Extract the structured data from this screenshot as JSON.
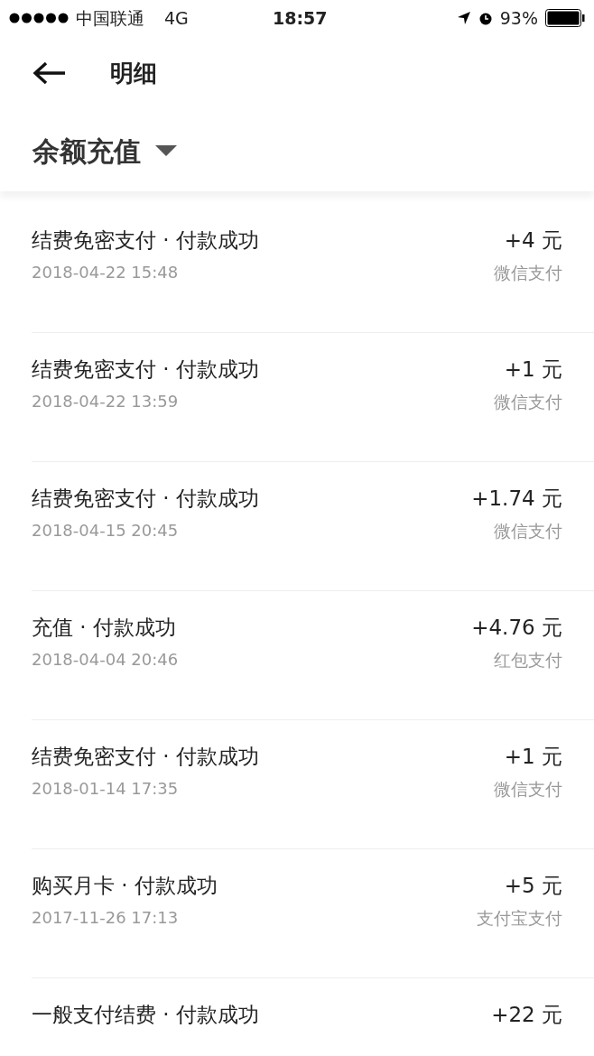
{
  "status_bar": {
    "carrier": "中国联通",
    "network": "4G",
    "time": "18:57",
    "battery": "93%"
  },
  "header": {
    "title": "明细"
  },
  "filter": {
    "label": "余额充值"
  },
  "records": [
    {
      "title": "结费免密支付 · 付款成功",
      "date": "2018-04-22 15:48",
      "amount": "+4 元",
      "method": "微信支付"
    },
    {
      "title": "结费免密支付 · 付款成功",
      "date": "2018-04-22 13:59",
      "amount": "+1 元",
      "method": "微信支付"
    },
    {
      "title": "结费免密支付 · 付款成功",
      "date": "2018-04-15 20:45",
      "amount": "+1.74 元",
      "method": "微信支付"
    },
    {
      "title": "充值 · 付款成功",
      "date": "2018-04-04 20:46",
      "amount": "+4.76 元",
      "method": "红包支付"
    },
    {
      "title": "结费免密支付 · 付款成功",
      "date": "2018-01-14 17:35",
      "amount": "+1 元",
      "method": "微信支付"
    },
    {
      "title": "购买月卡 · 付款成功",
      "date": "2017-11-26 17:13",
      "amount": "+5 元",
      "method": "支付宝支付"
    },
    {
      "title": "一般支付结费 · 付款成功",
      "amount": "+22 元"
    }
  ]
}
